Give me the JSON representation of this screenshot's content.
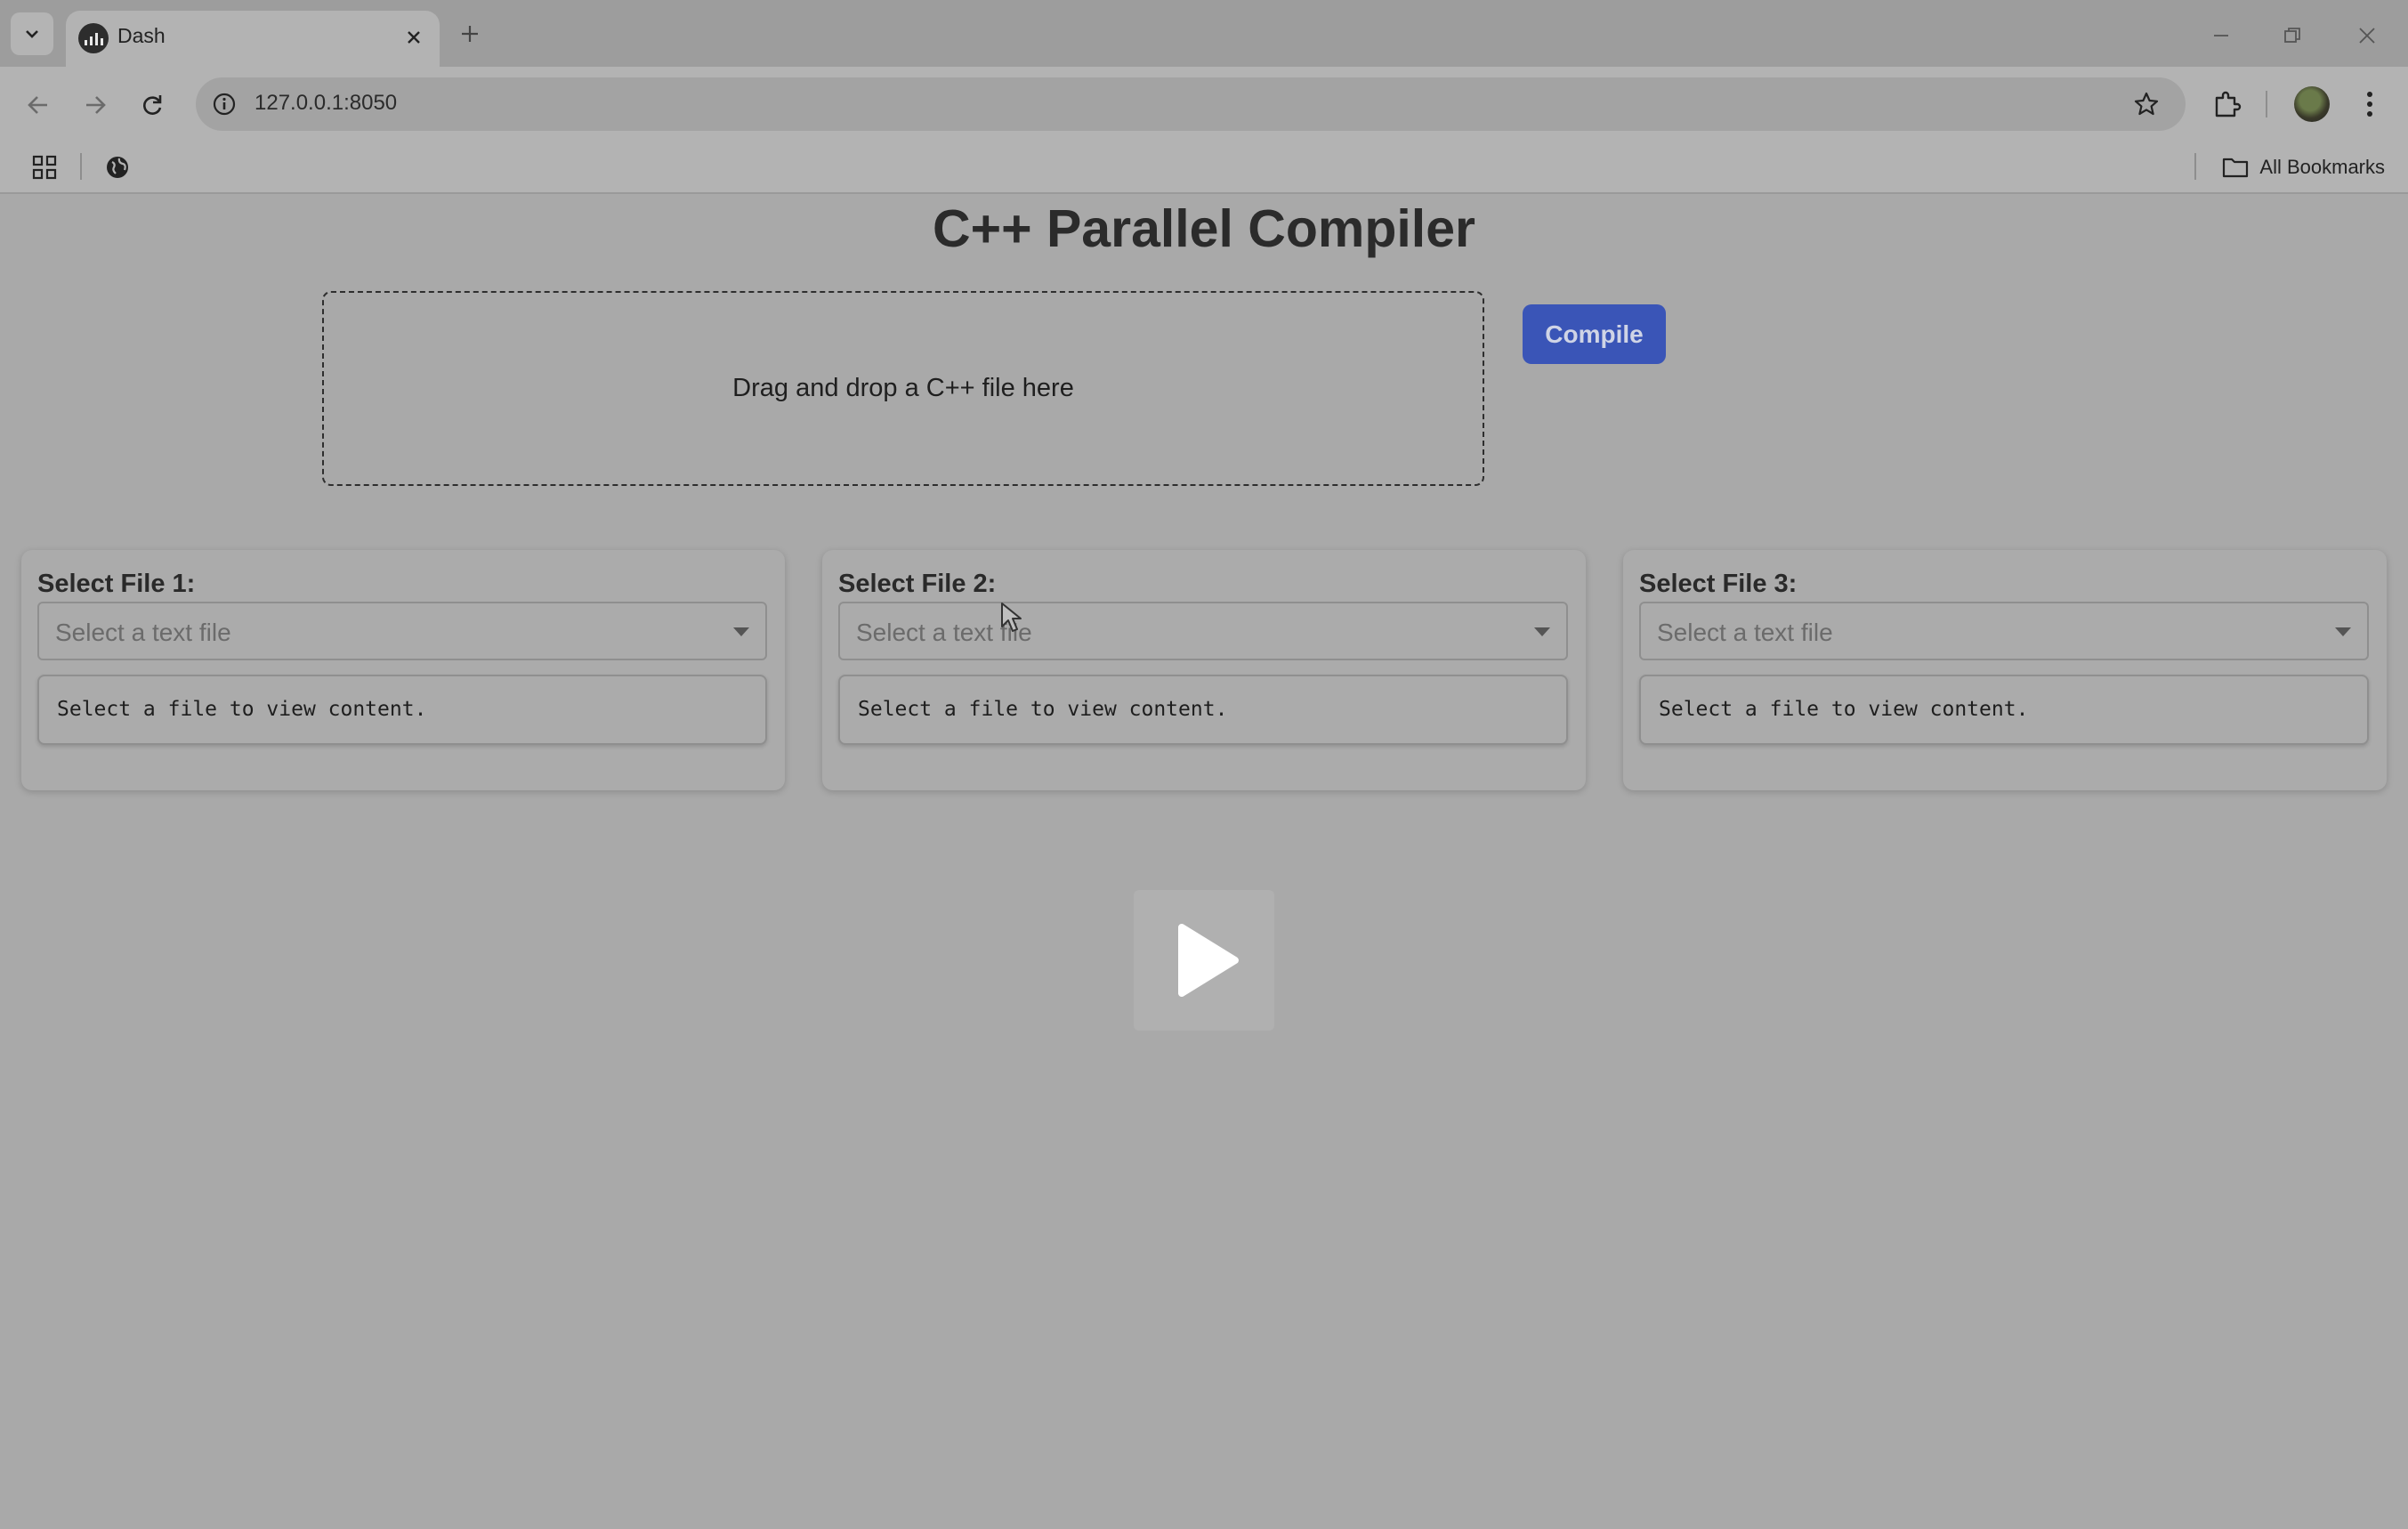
{
  "browser": {
    "tab": {
      "title": "Dash"
    },
    "address_bar": {
      "url": "127.0.0.1:8050"
    },
    "bookmarks_bar": {
      "all_bookmarks_label": "All Bookmarks"
    }
  },
  "page": {
    "title": "C++ Parallel Compiler",
    "upload": {
      "prompt": "Drag and drop a C++ file here"
    },
    "compile_button": {
      "label": "Compile"
    },
    "file_panels": [
      {
        "label": "Select File 1:",
        "dropdown_placeholder": "Select a text file",
        "content": "Select a file to view content."
      },
      {
        "label": "Select File 2:",
        "dropdown_placeholder": "Select a text file",
        "content": "Select a file to view content."
      },
      {
        "label": "Select File 3:",
        "dropdown_placeholder": "Select a text file",
        "content": "Select a file to view content."
      }
    ]
  },
  "icons": {
    "tab_search": "chevron-down-icon",
    "tab_favicon": "dash-bars-icon",
    "tab_close": "close-icon",
    "new_tab": "plus-icon",
    "back": "arrow-left-icon",
    "forward": "arrow-right-icon",
    "reload": "reload-icon",
    "site_info": "info-icon",
    "bookmark_star": "star-icon",
    "extensions": "puzzle-icon",
    "menu": "kebab-menu-icon",
    "apps": "apps-grid-icon",
    "globe": "globe-icon",
    "folder": "folder-icon",
    "play_overlay": "play-icon"
  },
  "colors": {
    "page_background": "#a9a9a9",
    "compile_button": "#3a55b7",
    "title_text": "#2b2b2b"
  }
}
